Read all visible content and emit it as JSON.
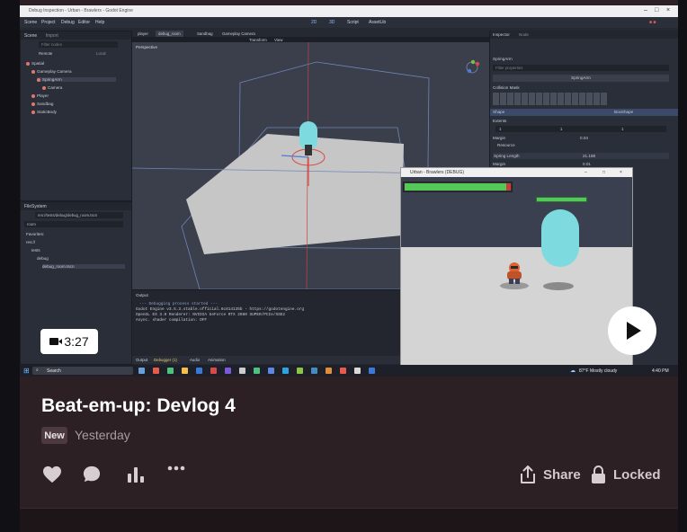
{
  "godot": {
    "window_title": "Debug Inspection - Urban - Brawlers - Godot Engine",
    "menu": [
      "Scene",
      "Project",
      "Debug",
      "Editor",
      "Help"
    ],
    "center_tabs": [
      "2D",
      "3D",
      "Script",
      "AssetLib"
    ],
    "scene_panel_title": "Scene",
    "import_tab": "Import",
    "filter_nodes": "Filter nodes",
    "remote_label": "Remote",
    "local_label": "Local",
    "tree": [
      "Spatial",
      "Gameplay Camera",
      "SpringArm",
      "Camera",
      "Player",
      "Sandbag",
      "StaticBody"
    ],
    "filesystem_title": "FileSystem",
    "fs_path": "res://tests/debug/debug_room.tscn",
    "fs_search": "room",
    "fs_items": [
      "Favorites:",
      "res://",
      "tests",
      "debug",
      "debug_room.tscn"
    ],
    "scene_tabs": [
      "player",
      "debug_room",
      "Sandbag",
      "Gameplay Camera"
    ],
    "viewport_label": "Perspective",
    "viewport_menu": [
      "Transform",
      "View"
    ],
    "output_title": "Output",
    "output_lines": [
      "--- Debugging process started ---",
      "Godot Engine v3.5.3.stable.official.6c814135b - https://godotengine.org",
      "OpenGL ES 3.0 Renderer: NVIDIA GeForce RTX 2080 SUPER/PCIe/SSE2",
      "Async. shader compilation: OFF"
    ],
    "bottom_tabs": [
      "Output",
      "Debugger (1)",
      "Audio",
      "Animation"
    ],
    "inspector_title": "Inspector",
    "node_tab": "Node",
    "inspector_node": "SpringArm",
    "filter_properties": "Filter properties",
    "collision_mask": "Collision Mask",
    "shape_label": "Shape",
    "shape_value": "BoxShape",
    "extents_label": "Extents",
    "margin_label": "Margin",
    "margin_value": "0.04",
    "resource_label": "Resource",
    "spring_length_label": "Spring Length",
    "spring_length_value": "21.188",
    "margin2_value": "0.01",
    "extent_values": [
      "1",
      "1",
      "1"
    ],
    "game_window_title": "Urban - Brawlers (DEBUG)",
    "player_hp": 0.96
  },
  "taskbar": {
    "search": "Search",
    "weather": "87°F Mostly cloudy",
    "time": "4:40 PM"
  },
  "video": {
    "duration": "3:27"
  },
  "post": {
    "title": "Beat-em-up: Devlog 4",
    "badge": "New",
    "date": "Yesterday",
    "share_label": "Share",
    "locked_label": "Locked"
  },
  "colors": {
    "card_bg": "#2d2025",
    "capsule": "#7ddbe0",
    "hp_green": "#55c85a"
  }
}
